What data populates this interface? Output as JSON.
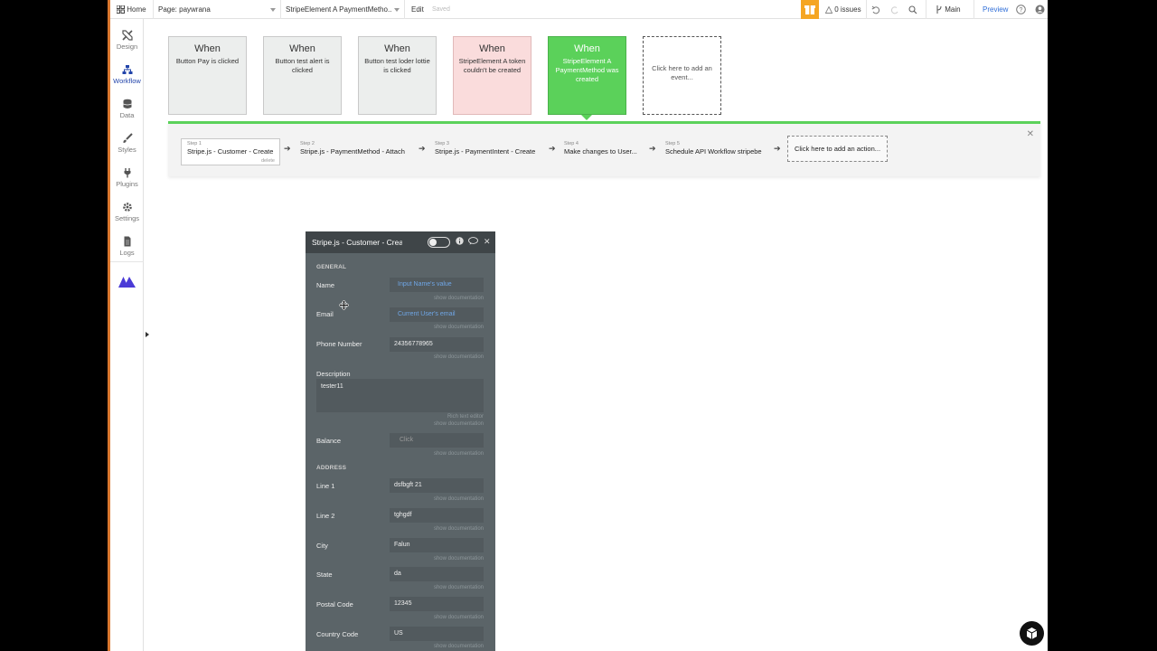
{
  "topbar": {
    "home_label": "Home",
    "page_label": "Page: paywrana",
    "element_label": "StripeElement A PaymentMetho...",
    "edit_label": "Edit",
    "saved_label": "Saved",
    "issues_label": "0 issues",
    "branch_label": "Main",
    "preview_label": "Preview"
  },
  "leftnav": {
    "items": [
      {
        "label": "Design",
        "icon": "design-icon"
      },
      {
        "label": "Workflow",
        "icon": "workflow-icon"
      },
      {
        "label": "Data",
        "icon": "data-icon"
      },
      {
        "label": "Styles",
        "icon": "brush-icon"
      },
      {
        "label": "Plugins",
        "icon": "plug-icon"
      },
      {
        "label": "Settings",
        "icon": "gear-icon"
      },
      {
        "label": "Logs",
        "icon": "logs-icon"
      }
    ],
    "active": "Workflow"
  },
  "events": [
    {
      "when": "When",
      "desc": "Button Pay is clicked",
      "state": "normal"
    },
    {
      "when": "When",
      "desc": "Button test alert is clicked",
      "state": "normal"
    },
    {
      "when": "When",
      "desc": "Button test loder lottie is clicked",
      "state": "normal"
    },
    {
      "when": "When",
      "desc": "StripeElement A token couldn't be created",
      "state": "error"
    },
    {
      "when": "When",
      "desc": "StripeElement A PaymentMethod was created",
      "state": "selected"
    },
    {
      "when": "",
      "desc": "Click here to add an event...",
      "state": "add"
    }
  ],
  "steps": [
    {
      "num": "Step 1",
      "label": "Stripe.js - Customer - Create",
      "delete": "delete"
    },
    {
      "num": "Step 2",
      "label": "Stripe.js - PaymentMethod - Attach"
    },
    {
      "num": "Step 3",
      "label": "Stripe.js - PaymentIntent - Create"
    },
    {
      "num": "Step 4",
      "label": "Make changes to User..."
    },
    {
      "num": "Step 5",
      "label": "Schedule API Workflow stripebe"
    }
  ],
  "add_action_label": "Click here to add an action...",
  "editor": {
    "title": "Stripe.js - Customer - Create",
    "general_header": "GENERAL",
    "address_header": "ADDRESS",
    "show_doc": "show documentation",
    "rich_text": "Rich text editor",
    "fields": {
      "name": {
        "label": "Name",
        "value": "Input Name's value"
      },
      "email": {
        "label": "Email",
        "value": "Current User's email"
      },
      "phone": {
        "label": "Phone Number",
        "value": "24356778965"
      },
      "description": {
        "label": "Description",
        "value": "tester11"
      },
      "balance": {
        "label": "Balance",
        "placeholder": "Click"
      },
      "line1": {
        "label": "Line 1",
        "value": "dsfbgft 21"
      },
      "line2": {
        "label": "Line 2",
        "value": "tghgdf"
      },
      "city": {
        "label": "City",
        "value": "Falun"
      },
      "state": {
        "label": "State",
        "value": "da"
      },
      "postal": {
        "label": "Postal Code",
        "value": "12345"
      },
      "country": {
        "label": "Country Code",
        "value": "US"
      }
    }
  },
  "colors": {
    "accent_green": "#5bd15a",
    "error_pink": "#fadcdc",
    "brand_purple": "#4b3bd6",
    "link_blue": "#2f6ed8",
    "editor_bg": "#5b6468"
  }
}
